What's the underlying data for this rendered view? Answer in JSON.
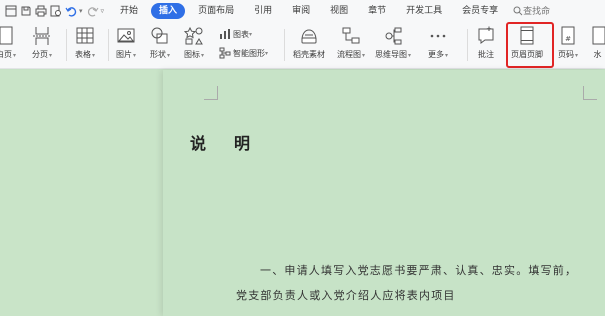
{
  "menubar": {
    "tabs": [
      "开始",
      "插入",
      "页面布局",
      "引用",
      "审阅",
      "视图",
      "章节",
      "开发工具",
      "会员专享"
    ],
    "active_tab": "插入",
    "search_text": "查找命"
  },
  "ribbon": {
    "page_break_label": "白页",
    "section_break_label": "分页",
    "table_label": "表格",
    "picture_label": "图片",
    "shape_label": "形状",
    "icon_label": "图标",
    "chart_label": "图表",
    "smartart_label": "智能图形",
    "rice_label": "稻壳素材",
    "flowchart_label": "流程图",
    "mindmap_label": "思维导图",
    "more_label": "更多",
    "comment_label": "批注",
    "header_footer_label": "页眉页脚",
    "page_number_label": "页码",
    "watermark_label": "水"
  },
  "document": {
    "title": "说明",
    "para1": "一、申请人填写入党志愿书要严肃、认真、忠实。填写前，",
    "para2": "党支部负责人或入党介绍人应将表内项目"
  },
  "colors": {
    "active_tab": "#2f6fe6",
    "highlight_box": "#e12525",
    "page_background": "#c7e3c7",
    "ribbon_background": "#f7f8f9"
  }
}
